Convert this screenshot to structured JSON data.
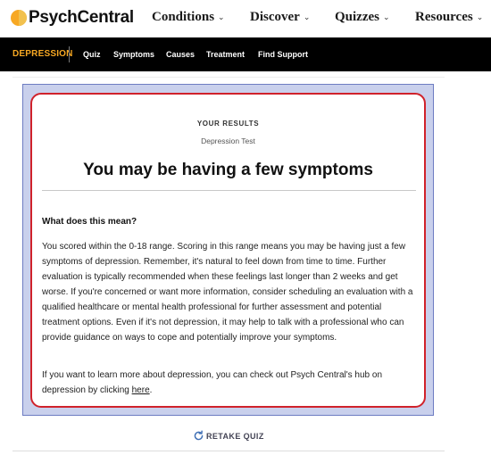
{
  "header": {
    "logo_text": "PsychCentral",
    "nav": [
      {
        "label": "Conditions"
      },
      {
        "label": "Discover"
      },
      {
        "label": "Quizzes"
      },
      {
        "label": "Resources"
      }
    ],
    "chevron_icon": "chevron-down-icon"
  },
  "subnav": {
    "brand": "DEPRESSION",
    "items": [
      "Quiz",
      "Symptoms",
      "Causes",
      "Treatment",
      "Find Support"
    ]
  },
  "results": {
    "eyebrow": "YOUR RESULTS",
    "test_name": "Depression Test",
    "headline": "You may be having a few symptoms",
    "question": "What does this mean?",
    "paragraph1": "You scored within the 0-18 range. Scoring in this range means you may be having just a few symptoms of depression. Remember, it's natural to feel down from time to time. Further evaluation is typically recommended when these feelings last longer than 2 weeks and get worse. If you're concerned or want more information, consider scheduling an evaluation with a qualified healthcare or mental health professional for further assessment and potential treatment options. Even if it's not depression, it may help to talk with a professional who can provide guidance on ways to cope and potentially improve your symptoms.",
    "paragraph2_prefix": "If you want to learn more about depression, you can check out Psych Central's hub on depression by clicking ",
    "paragraph2_link": "here",
    "paragraph2_suffix": "."
  },
  "retake": {
    "label": "RETAKE QUIZ",
    "icon": "refresh-icon"
  },
  "colors": {
    "brand_orange": "#f7a823",
    "highlight_red": "#d0222b",
    "frame_blue": "#c9d0ec"
  }
}
